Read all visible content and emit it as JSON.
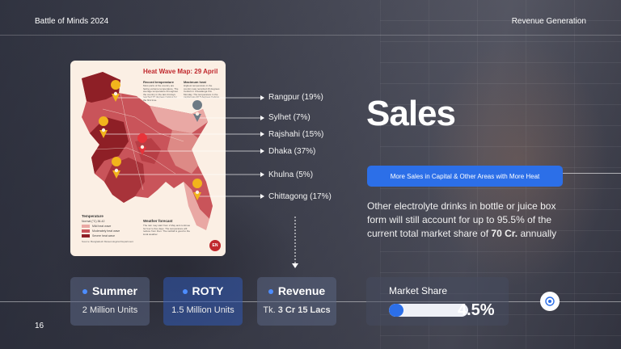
{
  "header": {
    "title": "Battle of Minds 2024",
    "section": "Revenue Generation"
  },
  "page_number": "16",
  "map": {
    "title": "Heat Wave Map: 29 April",
    "record_heading": "Record temperature",
    "record_text": "Most parts of the country are facing extreme temperature. The average temperature throughout the country in the last 24 days reached 37 degrees Celsius for the first time.",
    "max_heading": "Maximum heat",
    "max_text": "Highest temperature in the country was recorded 43 degrees Celsius in Chuadanga this Monday. The temperature in the capital was 40.5 degrees Celsius.",
    "legend_title": "Temperature",
    "legend_unit": "Normal (°C) 36-42",
    "legend_items": [
      {
        "label": "Mild heat wave",
        "color": "#e9a8a4"
      },
      {
        "label": "Moderately heat wave",
        "color": "#c9545a"
      },
      {
        "label": "Severe heat wave",
        "color": "#8e1f26"
      }
    ],
    "forecast_title": "Weather forecast",
    "forecast_text": "The rain may start from 2 May and continue for four to five days. The temperature will reduce from then. The rainfall is good to the local weather.",
    "source": "Source: Bangladesh Meteorological Department",
    "logo": "EN"
  },
  "regions": [
    {
      "label": "Rangpur (19%)"
    },
    {
      "label": "Sylhet (7%)"
    },
    {
      "label": "Rajshahi (15%)"
    },
    {
      "label": "Dhaka (37%)"
    },
    {
      "label": "Khulna (5%)"
    },
    {
      "label": "Chittagong (17%)"
    }
  ],
  "main": {
    "title": "Sales",
    "highlight": "More Sales in Capital & Other Areas with More Heat",
    "desc_prefix": "Other electrolyte drinks in bottle or juice box form will still account for up to 95.5% of the current total market share of ",
    "desc_bold": "70 Cr.",
    "desc_suffix": " annually"
  },
  "stats": [
    {
      "title": "Summer",
      "value": "2 Million Units"
    },
    {
      "title": "ROTY",
      "value": "1.5 Million Units"
    },
    {
      "title": "Revenue",
      "value_prefix": "Tk. ",
      "value_bold": "3 Cr 15 Lacs"
    }
  ],
  "market_share": {
    "label": "Market Share",
    "value": "4.5%",
    "fill_percent": 4.5
  },
  "colors": {
    "accent": "#2c6fe8",
    "map_dark": "#8e1f26",
    "map_mid": "#c9545a",
    "map_light": "#e9a8a4"
  },
  "icons": {
    "target": "target-icon",
    "pin": "map-pin-icon",
    "arrow": "arrow-down-icon"
  }
}
